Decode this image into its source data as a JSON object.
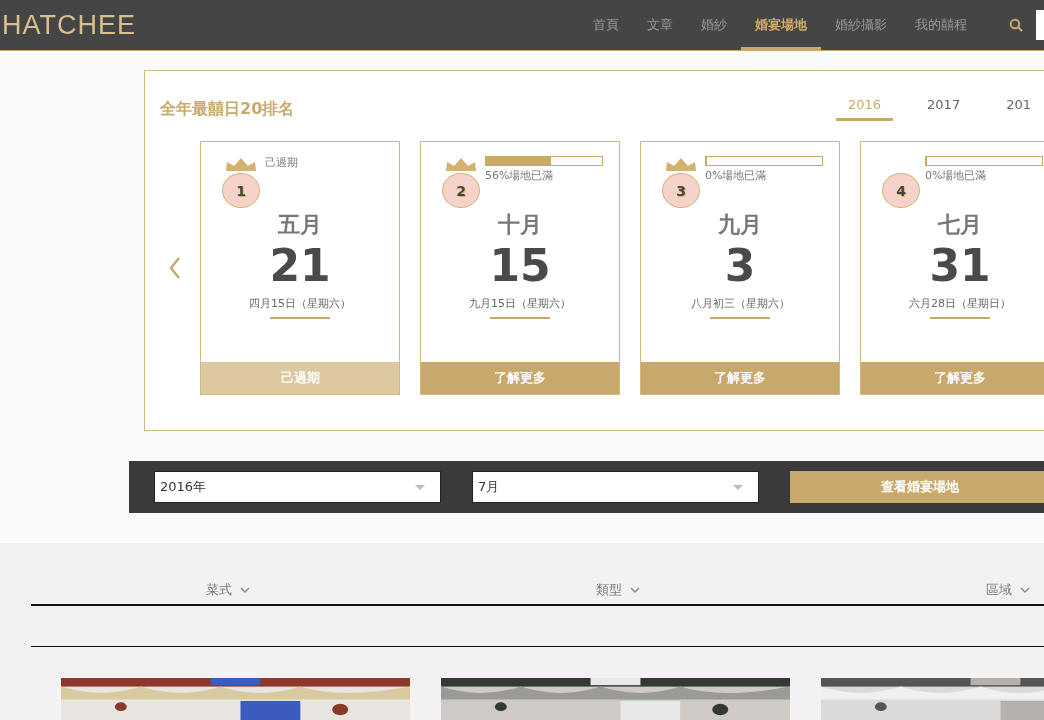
{
  "header": {
    "logo": "HATCHEE",
    "nav": [
      {
        "label": "首頁",
        "selected": false
      },
      {
        "label": "文章",
        "selected": false
      },
      {
        "label": "婚紗",
        "selected": false
      },
      {
        "label": "婚宴場地",
        "selected": true
      },
      {
        "label": "婚紗攝影",
        "selected": false
      },
      {
        "label": "我的囍程",
        "selected": false
      }
    ]
  },
  "ranking": {
    "title": "全年最囍日20排名",
    "years": [
      {
        "label": "2016",
        "selected": true
      },
      {
        "label": "2017",
        "selected": false
      },
      {
        "label": "201",
        "selected": false
      }
    ],
    "cards": [
      {
        "kind": "past",
        "rank": "1",
        "crown": true,
        "status": "己過期",
        "month": "五月",
        "day": "21",
        "lunar": "四月15日（星期六）",
        "button": "己過期"
      },
      {
        "kind": "open",
        "rank": "2",
        "crown": true,
        "level": 0.56,
        "status": "56%場地已滿",
        "month": "十月",
        "day": "15",
        "lunar": "九月15日（星期六）",
        "button": "了解更多"
      },
      {
        "kind": "open",
        "rank": "3",
        "crown": true,
        "level": 0,
        "status": "0%場地已滿",
        "month": "九月",
        "day": "3",
        "lunar": "八月初三（星期六）",
        "button": "了解更多"
      },
      {
        "kind": "open",
        "rank": "4",
        "crown": false,
        "level": 0,
        "status": "0%場地已滿",
        "month": "七月",
        "day": "31",
        "lunar": "六月28日（星期日）",
        "button": "了解更多"
      }
    ]
  },
  "search_bar": {
    "year": "2016年",
    "month": "7月",
    "button": "查看婚宴場地"
  },
  "filters": [
    {
      "label": "菜式"
    },
    {
      "label": "類型"
    },
    {
      "label": "區域"
    }
  ]
}
